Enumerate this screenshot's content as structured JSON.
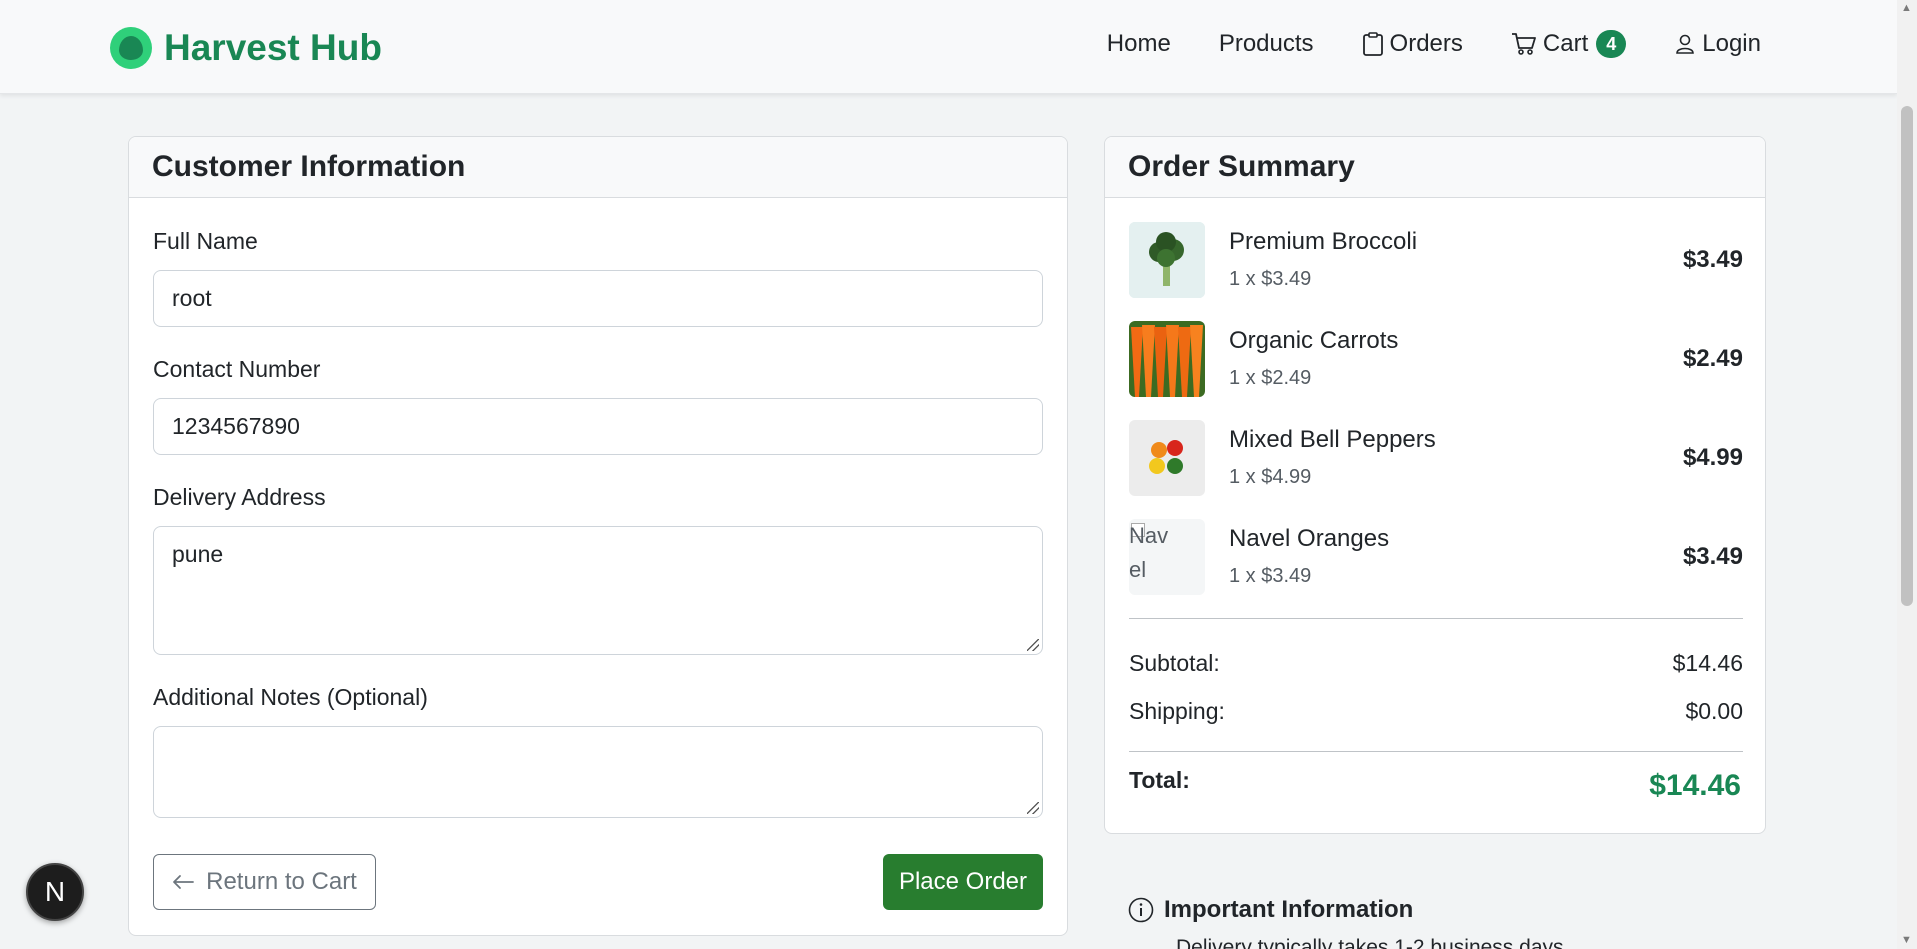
{
  "nav": {
    "brand": "Harvest Hub",
    "home": "Home",
    "products": "Products",
    "orders": "Orders",
    "cart": "Cart",
    "cart_count": "4",
    "login": "Login"
  },
  "customer": {
    "title": "Customer Information",
    "full_name_label": "Full Name",
    "full_name_value": "root",
    "contact_label": "Contact Number",
    "contact_value": "1234567890",
    "address_label": "Delivery Address",
    "address_value": "pune",
    "notes_label": "Additional Notes (Optional)",
    "notes_value": "",
    "return_button": "Return to Cart",
    "place_button": "Place Order"
  },
  "summary": {
    "title": "Order Summary",
    "items": [
      {
        "name": "Premium Broccoli",
        "qty": "1 x $3.49",
        "price": "$3.49"
      },
      {
        "name": "Organic Carrots",
        "qty": "1 x $2.49",
        "price": "$2.49"
      },
      {
        "name": "Mixed Bell Peppers",
        "qty": "1 x $4.99",
        "price": "$4.99"
      },
      {
        "name": "Navel Oranges",
        "qty": "1 x $3.49",
        "price": "$3.49",
        "image_alt": "Navel"
      }
    ],
    "subtotal_label": "Subtotal:",
    "subtotal_value": "$14.46",
    "shipping_label": "Shipping:",
    "shipping_value": "$0.00",
    "total_label": "Total:",
    "total_value": "$14.46"
  },
  "info": {
    "title": "Important Information",
    "line1": "Delivery typically takes 1-2 business days"
  },
  "dev_bubble": "N",
  "colors": {
    "brand": "#198754",
    "place_button": "#287d2f"
  }
}
